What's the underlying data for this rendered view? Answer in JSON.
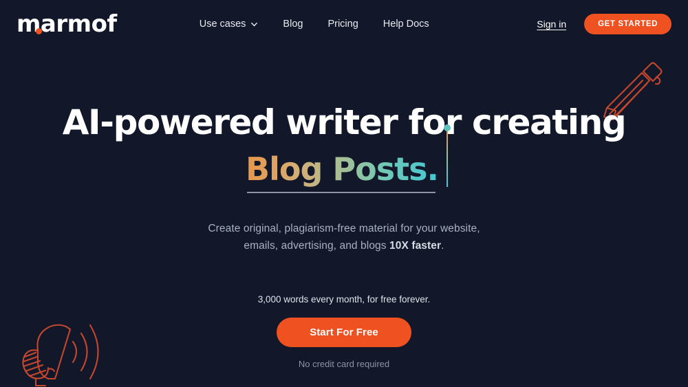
{
  "colors": {
    "background": "#121829",
    "accent_orange": "#ef5120",
    "decor_stroke": "#c4472e",
    "gradient_start": "#e8964a",
    "gradient_mid": "#a8be94",
    "gradient_end": "#3fc7d8",
    "muted_text": "#a9b1c2"
  },
  "header": {
    "logo": "marmof",
    "nav": [
      {
        "label": "Use cases",
        "has_dropdown": true,
        "icon": "chevron-down-icon"
      },
      {
        "label": "Blog",
        "has_dropdown": false
      },
      {
        "label": "Pricing",
        "has_dropdown": false
      },
      {
        "label": "Help Docs",
        "has_dropdown": false
      }
    ],
    "sign_in": "Sign in",
    "get_started": "GET STARTED"
  },
  "hero": {
    "headline": "AI-powered writer for creating",
    "typed_word": "Blog Posts.",
    "subtitle_line1": "Create original, plagiarism-free material for your website,",
    "subtitle_line2_pre": "emails, advertising, and blogs ",
    "subtitle_line2_bold": "10X faster",
    "subtitle_line2_post": ".",
    "free_note": "3,000 words every month, for free forever.",
    "cta_label": "Start For Free",
    "no_card_note": "No credit card required"
  },
  "decor": {
    "pencil_icon": "pencil-icon",
    "megaphone_icon": "megaphone-icon"
  }
}
